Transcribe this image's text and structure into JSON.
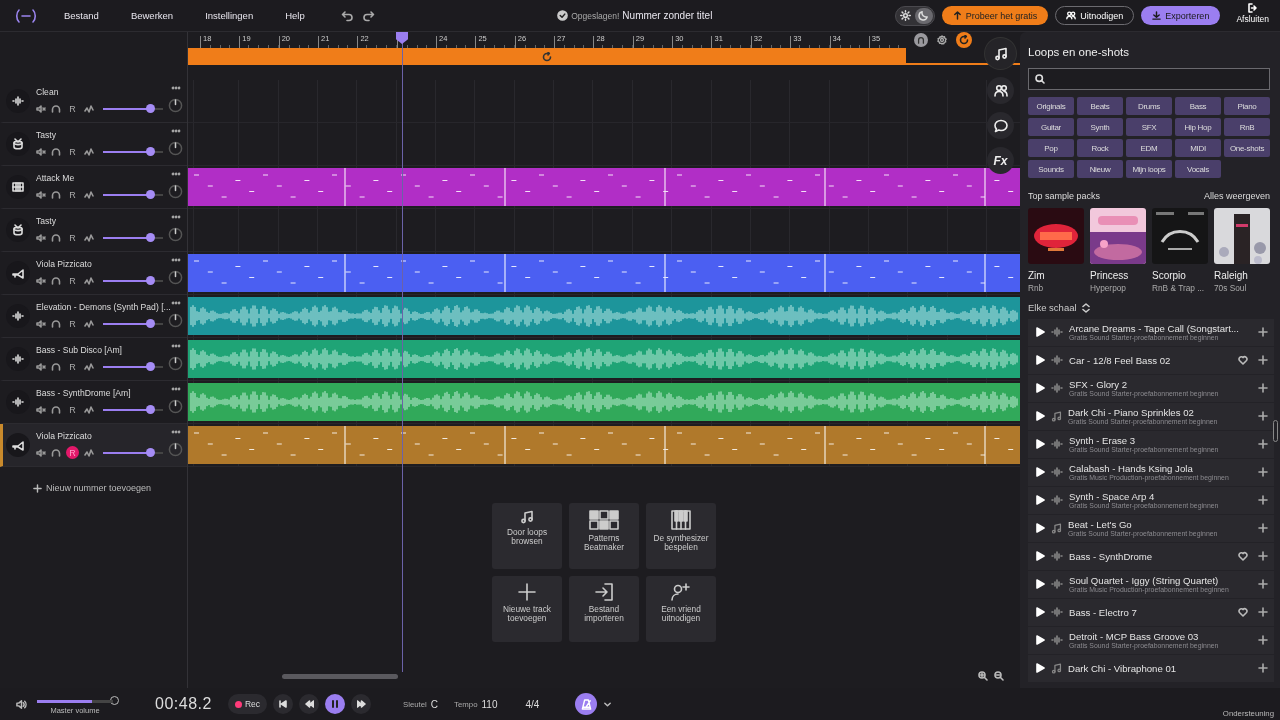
{
  "menu": [
    "Bestand",
    "Bewerken",
    "Instellingen",
    "Help"
  ],
  "status": {
    "saved": "Opgeslagen!",
    "title": "Nummer zonder titel"
  },
  "theme_toggle": [
    {
      "kind": "sun",
      "selected": false
    },
    {
      "kind": "moon",
      "selected": true
    }
  ],
  "actions": [
    {
      "kind": "upgrade",
      "label": "Probeer het gratis"
    },
    {
      "kind": "invite",
      "label": "Uitnodigen"
    },
    {
      "kind": "export",
      "label": "Exporteren"
    },
    {
      "kind": "exit",
      "label": "Afsluiten"
    }
  ],
  "ruler_before": [
    "18",
    "19",
    "20",
    "21",
    "22"
  ],
  "ruler_after": [
    "24",
    "25",
    "26",
    "27",
    "28",
    "29",
    "30",
    "31",
    "32",
    "33",
    "34",
    "35"
  ],
  "tracks": [
    {
      "name": "Clean",
      "kind": "audio",
      "record": "R",
      "armed": false,
      "selected": false
    },
    {
      "name": "Tasty",
      "kind": "drums",
      "record": "R",
      "armed": false,
      "selected": false
    },
    {
      "name": "Attack Me",
      "kind": "keys",
      "record": "R",
      "armed": false,
      "selected": false,
      "clip": {
        "kind": "midi",
        "color": "#b12ec6"
      }
    },
    {
      "name": "Tasty",
      "kind": "drums",
      "record": "R",
      "armed": false,
      "selected": false
    },
    {
      "name": "Viola Pizzicato",
      "kind": "horn",
      "record": "R",
      "armed": false,
      "selected": false,
      "clip": {
        "kind": "midi",
        "color": "#4b5ff2"
      }
    },
    {
      "name": "Elevation - Demons (Synth Pad) [...",
      "kind": "audio",
      "record": "R",
      "armed": false,
      "selected": false,
      "clip": {
        "kind": "audio",
        "color": "#1d959b"
      }
    },
    {
      "name": "Bass - Sub Disco [Am]",
      "kind": "audio",
      "record": "R",
      "armed": false,
      "selected": false,
      "clip": {
        "kind": "audio",
        "color": "#1fa476"
      }
    },
    {
      "name": "Bass - SynthDrome [Am]",
      "kind": "audio",
      "record": "R",
      "armed": false,
      "selected": false,
      "clip": {
        "kind": "audio",
        "color": "#31a95a"
      }
    },
    {
      "name": "Viola Pizzicato",
      "kind": "horn",
      "record": "R",
      "armed": true,
      "selected": true,
      "clip": {
        "kind": "midi",
        "color": "#b0792b"
      }
    }
  ],
  "add_track": "Nieuw nummer toevoegen",
  "side_tools": [
    {
      "kind": "note",
      "selected": true
    },
    {
      "kind": "people",
      "selected": false
    },
    {
      "kind": "chat",
      "selected": false
    },
    {
      "kind": "fx",
      "label": "Fx",
      "selected": false
    }
  ],
  "quick_start": [
    {
      "kind": "loops",
      "label": "Door loops browsen"
    },
    {
      "kind": "patterns",
      "label": "Patterns Beatmaker"
    },
    {
      "kind": "synth",
      "label": "De synthesizer bespelen"
    },
    {
      "kind": "add",
      "label": "Nieuwe track toevoegen"
    },
    {
      "kind": "import",
      "label": "Bestand importeren"
    },
    {
      "kind": "friend",
      "label": "Een vriend uitnodigen"
    }
  ],
  "loops": {
    "title": "Loops en one-shots",
    "tags": [
      "Originals",
      "Beats",
      "Drums",
      "Bass",
      "Piano",
      "Guitar",
      "Synth",
      "SFX",
      "Hip Hop",
      "RnB",
      "Pop",
      "Rock",
      "EDM",
      "MIDI",
      "One-shots",
      "Sounds",
      "Nieuw",
      "Mijn loops",
      "Vocals"
    ],
    "packs_title": "Top sample packs",
    "see_all": "Alles weergeven",
    "packs": [
      {
        "kind": "picture",
        "name": "Zim",
        "genre": "Rnb"
      },
      {
        "kind": "picture",
        "name": "Princess",
        "genre": "Hyperpop"
      },
      {
        "kind": "picture",
        "name": "Scorpio",
        "genre": "RnB & Trap ..."
      },
      {
        "kind": "picture",
        "name": "Raleigh",
        "genre": "70s Soul"
      }
    ],
    "scale": "Elke schaal",
    "items": [
      {
        "kind": "audio",
        "title": "Arcane Dreams - Tape Call (Songstart...",
        "subtitle": "Gratis Sound Starter-proefabonnement beginnen",
        "heart": false
      },
      {
        "kind": "audio",
        "title": "Car - 12/8 Feel Bass 02",
        "heart": true
      },
      {
        "kind": "audio",
        "title": "SFX - Glory 2",
        "subtitle": "Gratis Sound Starter-proefabonnement beginnen",
        "heart": false
      },
      {
        "kind": "midi",
        "title": "Dark Chi - Piano Sprinkles 02",
        "subtitle": "Gratis Sound Starter-proefabonnement beginnen",
        "heart": false
      },
      {
        "kind": "audio",
        "title": "Synth - Erase 3",
        "subtitle": "Gratis Sound Starter-proefabonnement beginnen",
        "heart": false
      },
      {
        "kind": "audio",
        "title": "Calabash - Hands Ksing Jola",
        "subtitle": "Gratis Music Production-proefabonnement beginnen",
        "heart": false
      },
      {
        "kind": "audio",
        "title": "Synth - Space Arp 4",
        "subtitle": "Gratis Sound Starter-proefabonnement beginnen",
        "heart": false
      },
      {
        "kind": "midi",
        "title": "Beat - Let's Go",
        "subtitle": "Gratis Sound Starter-proefabonnement beginnen",
        "heart": false
      },
      {
        "kind": "audio",
        "title": "Bass - SynthDrome",
        "heart": true
      },
      {
        "kind": "audio",
        "title": "Soul Quartet - Iggy (String Quartet)",
        "subtitle": "Gratis Music Production-proefabonnement beginnen",
        "heart": false
      },
      {
        "kind": "audio",
        "title": "Bass - Electro 7",
        "heart": true
      },
      {
        "kind": "audio",
        "title": "Detroit - MCP Bass Groove 03",
        "subtitle": "Gratis Sound Starter-proefabonnement beginnen",
        "heart": false
      },
      {
        "kind": "midi",
        "title": "Dark Chi - Vibraphone 01",
        "heart": false
      }
    ]
  },
  "transport": {
    "master_volume": {
      "label": "Master volume",
      "level": 0.72
    },
    "time": "00:48.2",
    "rec": "Rec",
    "playing": true,
    "key_label": "Sleutel",
    "key": "C",
    "tempo_label": "Tempo",
    "tempo": "110",
    "meter": "4/4",
    "metronome_on": true,
    "support": "Ondersteuning"
  }
}
